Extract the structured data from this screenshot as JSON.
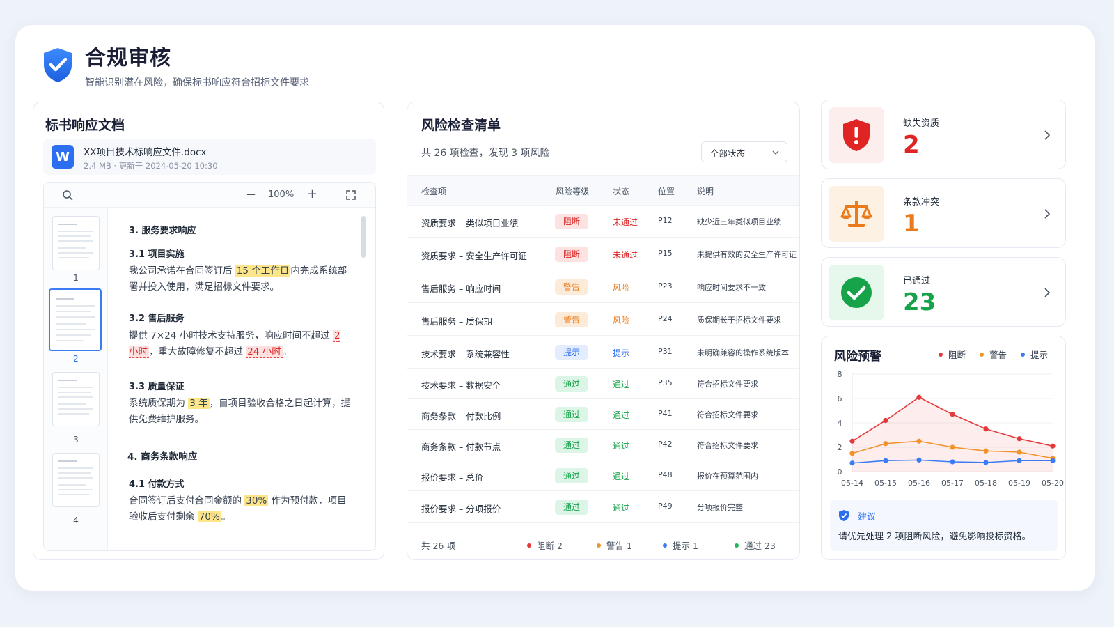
{
  "header": {
    "title": "合规审核",
    "subtitle": "智能识别潜在风险，确保标书响应符合招标文件要求"
  },
  "doc": {
    "title": "标书响应文档",
    "file_icon": "W",
    "file_name": "XX项目技术标响应文件.docx",
    "file_meta": "2.4 MB  ·  更新于 2024-05-20 10:30",
    "zoom": "100%",
    "pages": [
      "1",
      "2",
      "3",
      "4"
    ],
    "active_page": "2",
    "content": {
      "s3": "3. 服务要求响应",
      "s31": "3.1 项目实施",
      "s31_a": "我公司承诺在合同签订后 ",
      "s31_hl": "15 个工作日",
      "s31_b": "内完成系统部署并投入使用，满足招标文件要求。",
      "s32": "3.2 售后服务",
      "s32_a": "提供 7×24 小时技术支持服务，响应时间不超过 ",
      "s32_hl1": "2 小时",
      "s32_b": "，重大故障修复不超过 ",
      "s32_hl2": "24 小时",
      "s32_c": "。",
      "s33": "3.3 质量保证",
      "s33_a": "系统质保期为 ",
      "s33_hl": "3 年",
      "s33_b": "，自项目验收合格之日起计算，提供免费维护服务。",
      "s4": "4. 商务条款响应",
      "s41": "4.1 付款方式",
      "s41_a": "合同签订后支付合同金额的 ",
      "s41_hl1": "30%",
      "s41_b": " 作为预付款，项目验收后支付剩余 ",
      "s41_hl2": "70%",
      "s41_c": "。"
    }
  },
  "risk": {
    "title": "风险检查清单",
    "summary": "共 26 项检查，发现 3 项风险",
    "filter": "全部状态",
    "columns": [
      "检查项",
      "风险等级",
      "状态",
      "位置",
      "说明"
    ],
    "rows": [
      {
        "item": "资质要求 – 类似项目业绩",
        "level": "阻断",
        "lv": "red",
        "status": "未通过",
        "pos": "P12",
        "desc": "缺少近三年类似项目业绩"
      },
      {
        "item": "资质要求 – 安全生产许可证",
        "level": "阻断",
        "lv": "red",
        "status": "未通过",
        "pos": "P15",
        "desc": "未提供有效的安全生产许可证"
      },
      {
        "item": "售后服务 – 响应时间",
        "level": "警告",
        "lv": "org",
        "status": "风险",
        "pos": "P23",
        "desc": "响应时间要求不一致"
      },
      {
        "item": "售后服务 – 质保期",
        "level": "警告",
        "lv": "org",
        "status": "风险",
        "pos": "P24",
        "desc": "质保期长于招标文件要求"
      },
      {
        "item": "技术要求 – 系统兼容性",
        "level": "提示",
        "lv": "blue",
        "status": "提示",
        "pos": "P31",
        "desc": "未明确兼容的操作系统版本"
      },
      {
        "item": "技术要求 – 数据安全",
        "level": "通过",
        "lv": "green",
        "status": "通过",
        "pos": "P35",
        "desc": "符合招标文件要求"
      },
      {
        "item": "商务条款 – 付款比例",
        "level": "通过",
        "lv": "green",
        "status": "通过",
        "pos": "P41",
        "desc": "符合招标文件要求"
      },
      {
        "item": "商务条款 – 付款节点",
        "level": "通过",
        "lv": "green",
        "status": "通过",
        "pos": "P42",
        "desc": "符合招标文件要求"
      },
      {
        "item": "报价要求 – 总价",
        "level": "通过",
        "lv": "green",
        "status": "通过",
        "pos": "P48",
        "desc": "报价在预算范围内"
      },
      {
        "item": "报价要求 – 分项报价",
        "level": "通过",
        "lv": "green",
        "status": "通过",
        "pos": "P49",
        "desc": "分项报价完整"
      }
    ],
    "footer": {
      "total": "共 26 项",
      "block": "阻断  2",
      "warn": "警告  1",
      "hint": "提示  1",
      "pass": "通过  23"
    }
  },
  "summary_cards": [
    {
      "label": "缺失资质",
      "value": "2",
      "color": "#e02424",
      "icon": "shield-alert-icon"
    },
    {
      "label": "条款冲突",
      "value": "1",
      "color": "#ea7a1a",
      "icon": "scale-icon"
    },
    {
      "label": "已通过",
      "value": "23",
      "color": "#16a34a",
      "icon": "check-circle-icon"
    }
  ],
  "warning": {
    "title": "风险预警",
    "legend": [
      "阻断",
      "警告",
      "提示"
    ],
    "advice_title": "建议",
    "advice_text": "请优先处理 2 项阻断风险，避免影响投标资格。"
  },
  "colors": {
    "primary": "#2b6ff0",
    "red": "#e5383b",
    "orange": "#f0932b",
    "blue": "#3b7cf5",
    "green": "#16a34a"
  },
  "chart_data": {
    "type": "line",
    "x": [
      "05-14",
      "05-15",
      "05-16",
      "05-17",
      "05-18",
      "05-19",
      "05-20"
    ],
    "series": [
      {
        "name": "阻断",
        "values": [
          2.5,
          4.2,
          6.1,
          4.7,
          3.5,
          2.7,
          2.1
        ]
      },
      {
        "name": "警告",
        "values": [
          1.5,
          2.3,
          2.5,
          2.0,
          1.7,
          1.6,
          1.1
        ]
      },
      {
        "name": "提示",
        "values": [
          0.7,
          0.9,
          0.95,
          0.8,
          0.75,
          0.9,
          0.9
        ]
      }
    ],
    "ylim": [
      0,
      8
    ],
    "yticks": [
      "0",
      "2",
      "4",
      "6",
      "8"
    ],
    "grid": true,
    "legend": "top-right"
  }
}
